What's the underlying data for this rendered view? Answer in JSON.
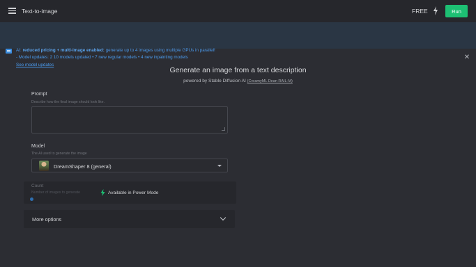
{
  "header": {
    "app_title": "Text-to-image",
    "plan_label": "FREE",
    "run_label": "Run",
    "accent_color": "#1dbf73"
  },
  "banner": {
    "line1_prefix": "AI:",
    "line1_bold": "reduced pricing + multi-image enabled:",
    "line1_rest": "generate up to 4 images using multiple GPUs in parallel!",
    "line2": "Model updates: 2 ",
    "line2_full": "- Model updates: 2 10 models updated • 7 new regular models • 4 new inpainting models",
    "link": "See model updates",
    "close_icon": "close-icon",
    "color": "#4a9cf0"
  },
  "main": {
    "heading": "Generate an image from a text description",
    "subheading": "powered by Stable Diffusion AI",
    "credit": "(CreamyML Dean RAIL-M)"
  },
  "prompt": {
    "label": "Prompt",
    "hint": "Describe how the final image should look like.",
    "value": ""
  },
  "model": {
    "label": "Model",
    "hint": "The AI used to generate the image",
    "selected": "DreamShaper 8 (general)"
  },
  "count": {
    "label": "Count",
    "hint": "Number of images to generate",
    "power_text": "Available in Power Mode"
  },
  "more_options": {
    "label": "More options"
  }
}
